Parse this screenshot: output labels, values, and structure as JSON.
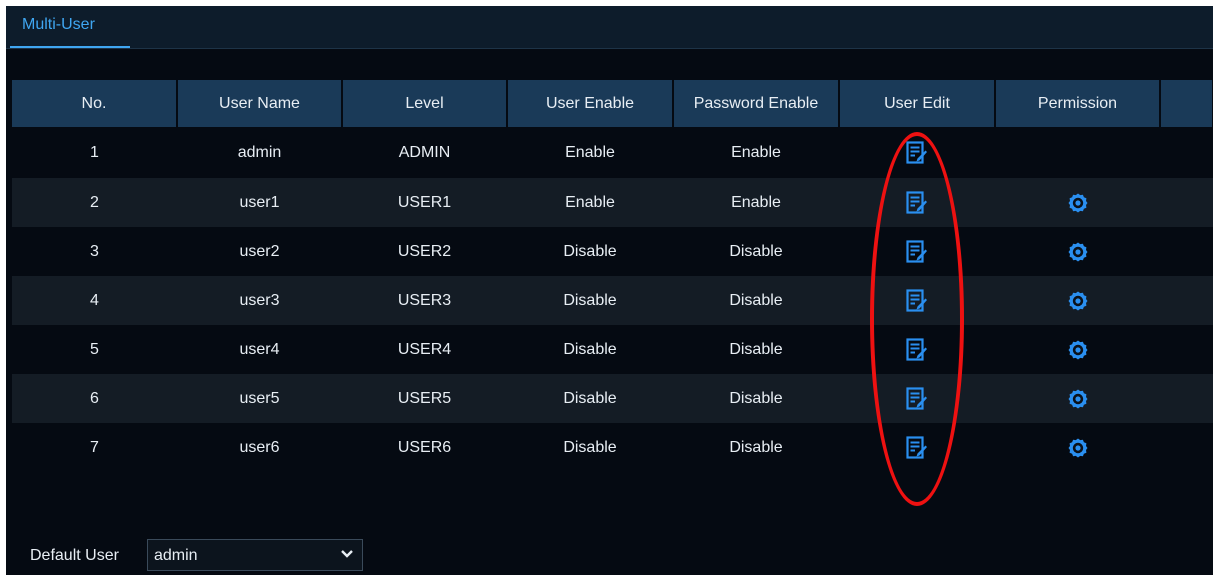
{
  "tabs": [
    {
      "label": "Multi-User",
      "active": true
    }
  ],
  "table": {
    "headers": [
      "No.",
      "User Name",
      "Level",
      "User Enable",
      "Password Enable",
      "User Edit",
      "Permission"
    ],
    "rows": [
      {
        "no": "1",
        "user_name": "admin",
        "level": "ADMIN",
        "user_enable": "Enable",
        "password_enable": "Enable",
        "edit_icon": "edit-icon",
        "permission_icon": null
      },
      {
        "no": "2",
        "user_name": "user1",
        "level": "USER1",
        "user_enable": "Enable",
        "password_enable": "Enable",
        "edit_icon": "edit-icon",
        "permission_icon": "gear-icon"
      },
      {
        "no": "3",
        "user_name": "user2",
        "level": "USER2",
        "user_enable": "Disable",
        "password_enable": "Disable",
        "edit_icon": "edit-icon",
        "permission_icon": "gear-icon"
      },
      {
        "no": "4",
        "user_name": "user3",
        "level": "USER3",
        "user_enable": "Disable",
        "password_enable": "Disable",
        "edit_icon": "edit-icon",
        "permission_icon": "gear-icon"
      },
      {
        "no": "5",
        "user_name": "user4",
        "level": "USER4",
        "user_enable": "Disable",
        "password_enable": "Disable",
        "edit_icon": "edit-icon",
        "permission_icon": "gear-icon"
      },
      {
        "no": "6",
        "user_name": "user5",
        "level": "USER5",
        "user_enable": "Disable",
        "password_enable": "Disable",
        "edit_icon": "edit-icon",
        "permission_icon": "gear-icon"
      },
      {
        "no": "7",
        "user_name": "user6",
        "level": "USER6",
        "user_enable": "Disable",
        "password_enable": "Disable",
        "edit_icon": "edit-icon",
        "permission_icon": "gear-icon"
      }
    ]
  },
  "default_user": {
    "label": "Default User",
    "selected": "admin"
  },
  "colors": {
    "accent": "#3fa6f1",
    "icon_blue": "#2a8ff0",
    "header_bg": "#1a3a58",
    "highlight": "#ee1111"
  }
}
